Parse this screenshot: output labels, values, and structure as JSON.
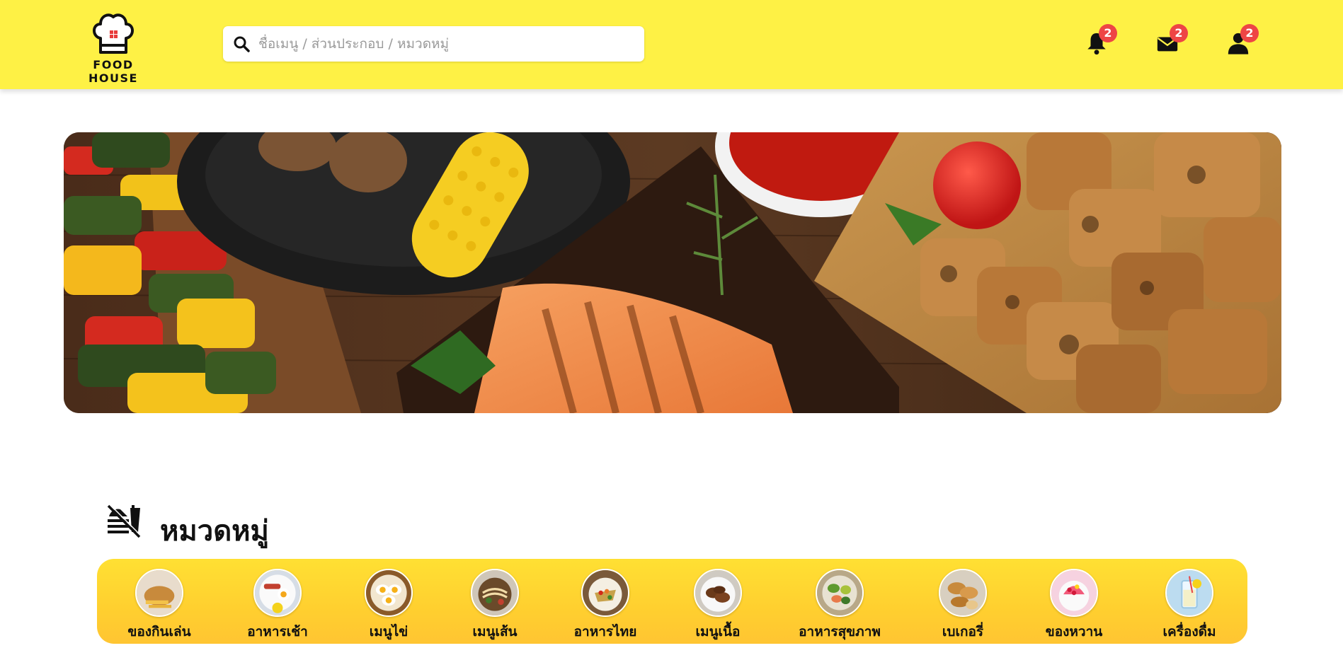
{
  "logo": {
    "text": "FOOD HOUSE"
  },
  "search": {
    "placeholder": "ชื่อเมนู / ส่วนประกอบ / หมวดหมู่"
  },
  "header_icons": {
    "notifications": {
      "icon": "bell-icon",
      "count": "2"
    },
    "messages": {
      "icon": "envelope-icon",
      "count": "2"
    },
    "profile": {
      "icon": "user-icon",
      "count": "2"
    }
  },
  "banner": {
    "image": "grilled-food-banner"
  },
  "categories_section": {
    "title": "หมวดหมู่",
    "icon": "no-food-icon",
    "items": [
      {
        "label": "ของกินเล่น",
        "image": "snack-thumb"
      },
      {
        "label": "อาหารเช้า",
        "image": "breakfast-thumb"
      },
      {
        "label": "เมนูไข่",
        "image": "egg-thumb"
      },
      {
        "label": "เมนูเส้น",
        "image": "noodle-thumb"
      },
      {
        "label": "อาหารไทย",
        "image": "thai-food-thumb"
      },
      {
        "label": "เมนูเนื้อ",
        "image": "meat-thumb"
      },
      {
        "label": "อาหารสุขภาพ",
        "image": "healthy-food-thumb"
      },
      {
        "label": "เบเกอรี่",
        "image": "bakery-thumb"
      },
      {
        "label": "ของหวาน",
        "image": "dessert-thumb"
      },
      {
        "label": "เครื่องดื่ม",
        "image": "drink-thumb"
      }
    ]
  },
  "colors": {
    "header_bg": "#fef145",
    "badge": "#ee4545",
    "category_bar": "#ffd12f"
  }
}
